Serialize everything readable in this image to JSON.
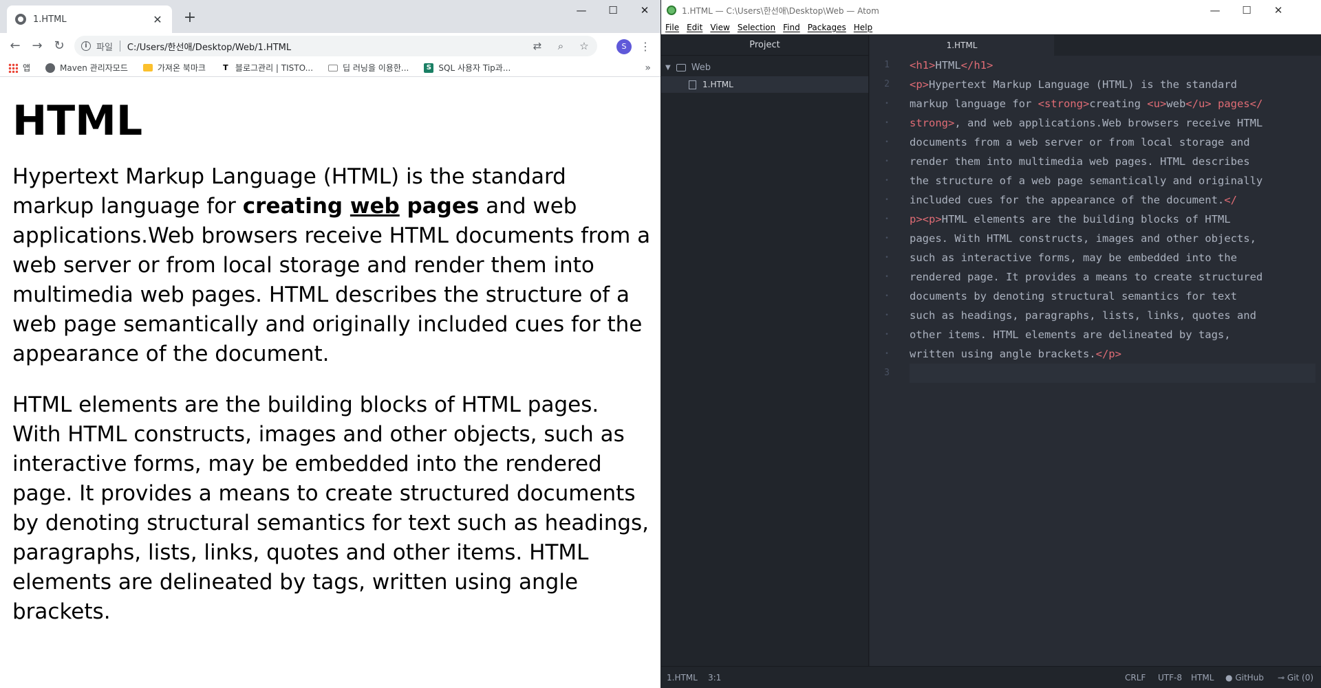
{
  "chrome": {
    "tab_title": "1.HTML",
    "tab_close": "✕",
    "new_tab": "+",
    "win_min": "—",
    "win_max": "☐",
    "win_close": "✕",
    "back": "←",
    "forward": "→",
    "reload": "↻",
    "scheme_label": "파일",
    "url": "C:/Users/한선애/Desktop/Web/1.HTML",
    "avatar_letter": "S",
    "menu": "⋮",
    "bookmarks": [
      {
        "label": "앱",
        "icon": "apps-grid-icon"
      },
      {
        "label": "Maven 관리자모드",
        "icon": "globe-icon"
      },
      {
        "label": "가져온 북마크",
        "icon": "folder-icon"
      },
      {
        "label": "블로그관리 | TISTO...",
        "icon": "tistory-icon"
      },
      {
        "label": "딥 러닝을 이용한...",
        "icon": "site-icon"
      },
      {
        "label": "SQL 사용자 Tip과...",
        "icon": "s-icon"
      }
    ],
    "bookmarks_more": "»"
  },
  "page": {
    "heading": "HTML",
    "p1_before": "Hypertext Markup Language (HTML) is the standard markup language for ",
    "p1_strong1": "creating ",
    "p1_underline": "web",
    "p1_strong2": " pages",
    "p1_after": " and web applications.Web browsers receive HTML documents from a web server or from local storage and render them into multimedia web pages. HTML describes the structure of a web page semantically and originally included cues for the appearance of the document.",
    "p2": "HTML elements are the building blocks of HTML pages. With HTML constructs, images and other objects, such as interactive forms, may be embedded into the rendered page. It provides a means to create structured documents by denoting structural semantics for text such as headings, paragraphs, lists, links, quotes and other items. HTML elements are delineated by tags, written using angle brackets."
  },
  "atom": {
    "title": "1.HTML — C:\\Users\\한선애\\Desktop\\Web — Atom",
    "menu": [
      "File",
      "Edit",
      "View",
      "Selection",
      "Find",
      "Packages",
      "Help"
    ],
    "project_header": "Project",
    "folder": "Web",
    "file": "1.HTML",
    "editor_tab": "1.HTML",
    "status": {
      "file": "1.HTML",
      "cursor": "3:1",
      "line_ending": "CRLF",
      "encoding": "UTF-8",
      "grammar": "HTML",
      "github": "GitHub",
      "git": "Git (0)"
    }
  },
  "code_lines": [
    {
      "gutter": "1",
      "parts": [
        [
          "tag",
          "<h1>"
        ],
        [
          "",
          "HTML"
        ],
        [
          "tag",
          "</h1>"
        ]
      ]
    },
    {
      "gutter": "2",
      "parts": [
        [
          "tag",
          "<p>"
        ],
        [
          "",
          "Hypertext Markup Language (HTML) is the standard"
        ]
      ]
    },
    {
      "gutter": "•",
      "parts": [
        [
          "",
          "markup language for "
        ],
        [
          "tag",
          "<strong>"
        ],
        [
          "",
          "creating "
        ],
        [
          "tag",
          "<u>"
        ],
        [
          "",
          "web"
        ],
        [
          "tag",
          "</u>"
        ],
        [
          "tag",
          " pages</"
        ]
      ]
    },
    {
      "gutter": "•",
      "parts": [
        [
          "tag",
          "strong>"
        ],
        [
          "",
          ", and web applications.Web browsers receive HTML"
        ]
      ]
    },
    {
      "gutter": "•",
      "parts": [
        [
          "",
          "documents from a web server or from local storage and"
        ]
      ]
    },
    {
      "gutter": "•",
      "parts": [
        [
          "",
          "render them into multimedia web pages. HTML describes"
        ]
      ]
    },
    {
      "gutter": "•",
      "parts": [
        [
          "",
          "the structure of a web page semantically and originally"
        ]
      ]
    },
    {
      "gutter": "•",
      "parts": [
        [
          "",
          "included cues for the appearance of the document."
        ],
        [
          "tag",
          "</"
        ]
      ]
    },
    {
      "gutter": "•",
      "parts": [
        [
          "tag",
          "p><p>"
        ],
        [
          "",
          "HTML elements are the building blocks of HTML"
        ]
      ]
    },
    {
      "gutter": "•",
      "parts": [
        [
          "",
          "pages. With HTML constructs, images and other objects,"
        ]
      ]
    },
    {
      "gutter": "•",
      "parts": [
        [
          "",
          "such as interactive forms, may be embedded into the"
        ]
      ]
    },
    {
      "gutter": "•",
      "parts": [
        [
          "",
          "rendered page. It provides a means to create structured"
        ]
      ]
    },
    {
      "gutter": "•",
      "parts": [
        [
          "",
          "documents by denoting structural semantics for text"
        ]
      ]
    },
    {
      "gutter": "•",
      "parts": [
        [
          "",
          "such as headings, paragraphs, lists, links, quotes and"
        ]
      ]
    },
    {
      "gutter": "•",
      "parts": [
        [
          "",
          "other items. HTML elements are delineated by tags,"
        ]
      ]
    },
    {
      "gutter": "•",
      "parts": [
        [
          "",
          "written using angle brackets."
        ],
        [
          "tag",
          "</p>"
        ]
      ]
    },
    {
      "gutter": "3",
      "parts": []
    }
  ]
}
